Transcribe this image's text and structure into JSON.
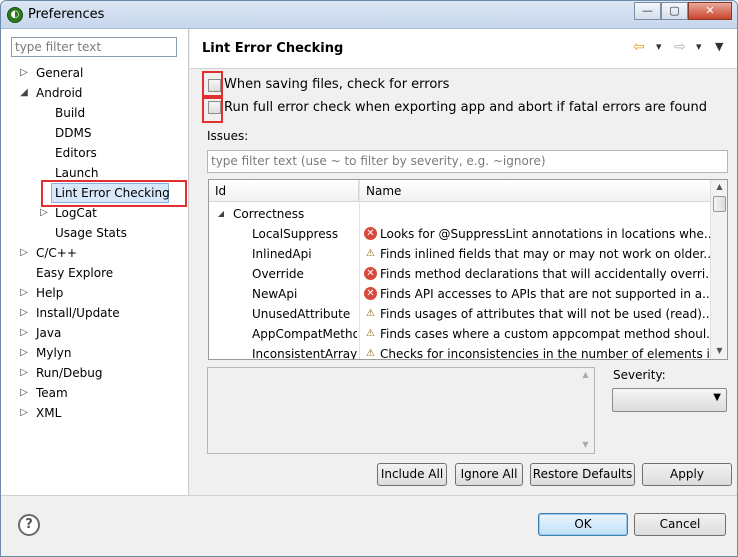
{
  "window": {
    "title": "Preferences",
    "min": "—",
    "max": "▢",
    "close": "✕"
  },
  "sidebar": {
    "filter_placeholder": "type filter text",
    "items": [
      {
        "label": "General",
        "exp": "▷"
      },
      {
        "label": "Android",
        "exp": "◢"
      },
      {
        "label": "Build",
        "exp": ""
      },
      {
        "label": "DDMS",
        "exp": ""
      },
      {
        "label": "Editors",
        "exp": ""
      },
      {
        "label": "Launch",
        "exp": ""
      },
      {
        "label": "Lint Error Checking",
        "exp": ""
      },
      {
        "label": "LogCat",
        "exp": "▷"
      },
      {
        "label": "Usage Stats",
        "exp": ""
      },
      {
        "label": "C/C++",
        "exp": "▷"
      },
      {
        "label": "Easy Explore",
        "exp": ""
      },
      {
        "label": "Help",
        "exp": "▷"
      },
      {
        "label": "Install/Update",
        "exp": "▷"
      },
      {
        "label": "Java",
        "exp": "▷"
      },
      {
        "label": "Mylyn",
        "exp": "▷"
      },
      {
        "label": "Run/Debug",
        "exp": "▷"
      },
      {
        "label": "Team",
        "exp": "▷"
      },
      {
        "label": "XML",
        "exp": "▷"
      }
    ]
  },
  "page": {
    "title": "Lint Error Checking",
    "nav_back": "⇦",
    "nav_back_menu": "▾",
    "nav_fwd": "⇨",
    "nav_fwd_menu": "▾",
    "view_menu": "▼",
    "check_save": {
      "label": "When saving files, check for errors",
      "checked": false
    },
    "check_export": {
      "label": "Run full error check when exporting app and abort if fatal errors are found",
      "checked": false
    },
    "issues_label": "Issues:",
    "issues_filter_placeholder": "type filter text (use ~ to filter by severity, e.g. ~ignore)",
    "columns": {
      "id": "Id",
      "name": "Name"
    },
    "category": {
      "label": "Correctness",
      "exp": "◢"
    },
    "rows": [
      {
        "id": "LocalSuppress",
        "sev": "error",
        "sev_icon": "✕",
        "name": "Looks for @SuppressLint annotations in locations whe..."
      },
      {
        "id": "InlinedApi",
        "sev": "warning",
        "sev_icon": "⚠",
        "name": "Finds inlined fields that may or may not work on older..."
      },
      {
        "id": "Override",
        "sev": "error",
        "sev_icon": "✕",
        "name": "Finds method declarations that will accidentally overri..."
      },
      {
        "id": "NewApi",
        "sev": "error",
        "sev_icon": "✕",
        "name": "Finds API accesses to APIs that are not supported in a..."
      },
      {
        "id": "UnusedAttribute",
        "sev": "warning",
        "sev_icon": "⚠",
        "name": "Finds usages of attributes that will not be used (read)..."
      },
      {
        "id": "AppCompatMetho",
        "sev": "warning",
        "sev_icon": "⚠",
        "name": "Finds cases where a custom appcompat method shoul..."
      },
      {
        "id": "InconsistentArrays",
        "sev": "warning",
        "sev_icon": "⚠",
        "name": "Checks for inconsistencies in the number of elements i..."
      }
    ],
    "severity_label": "Severity:",
    "severity_value": "",
    "buttons": {
      "include_all": "Include All",
      "ignore_all": "Ignore All",
      "restore_defaults": "Restore Defaults",
      "apply": "Apply"
    }
  },
  "footer": {
    "help_icon": "?",
    "ok": "OK",
    "cancel": "Cancel"
  }
}
